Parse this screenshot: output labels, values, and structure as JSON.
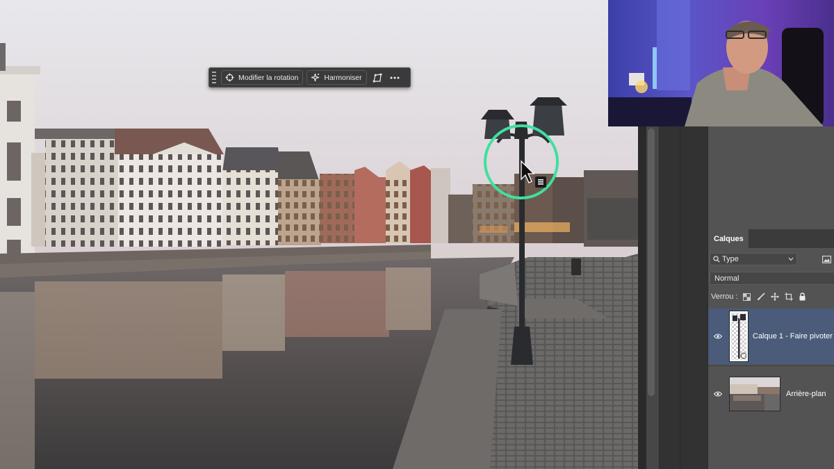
{
  "canvas": {
    "taskbar": {
      "rotate_label": "Modifier la rotation",
      "harmonize_label": "Harmoniser",
      "rotate_icon": "rotate-crosshair-icon",
      "harmonize_icon": "sparkle-icon",
      "transform_icon": "perspective-transform-icon",
      "more_icon": "more-dots-icon"
    },
    "cursor_icon": "arrow-cursor-icon",
    "cursor_badge_icon": "menu-badge-icon",
    "highlight_color": "#3fe0a0"
  },
  "layers_panel": {
    "tab_label": "Calques",
    "filter": {
      "icon": "search-icon",
      "label": "Type"
    },
    "filter_image_icon": "image-filter-icon",
    "blend_mode": "Normal",
    "lock_label": "Verrou :",
    "lock_icons": [
      "lock-transparency-icon",
      "lock-brush-icon",
      "lock-move-icon",
      "lock-artboard-icon",
      "lock-all-icon"
    ],
    "layers": [
      {
        "name": "Calque 1 - Faire pivoter",
        "selected": true,
        "visible": true
      },
      {
        "name": "Arrière-plan",
        "selected": false,
        "visible": true
      }
    ],
    "selection_color": "#4a5c7a"
  }
}
